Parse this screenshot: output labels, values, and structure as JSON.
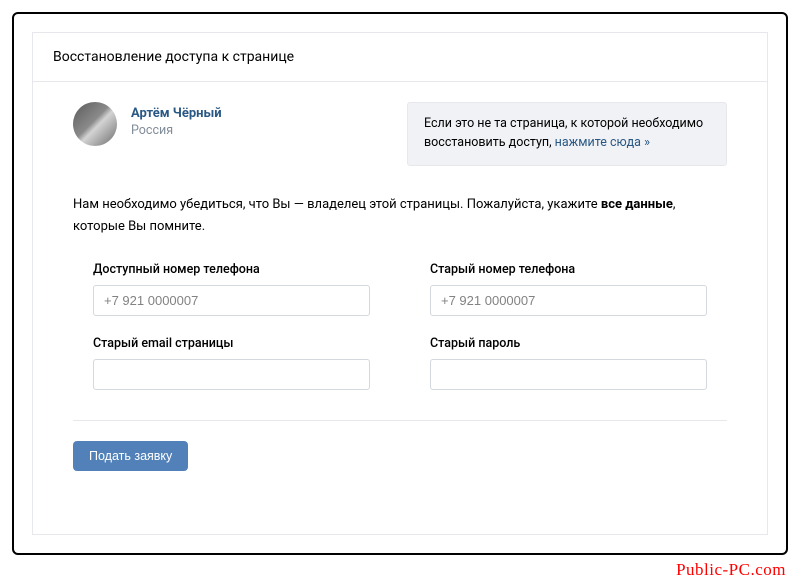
{
  "header": {
    "title": "Восстановление доступа к странице"
  },
  "user": {
    "name": "Артём Чёрный",
    "location": "Россия"
  },
  "infobox": {
    "text_prefix": "Если это не та страница, к которой необходимо восстановить доступ, ",
    "link_text": "нажмите сюда »"
  },
  "instruction": {
    "part1": "Нам необходимо убедиться, что Вы — владелец этой страницы. Пожалуйста, укажите ",
    "bold": "все данные",
    "part2": ", которые Вы помните."
  },
  "fields": {
    "available_phone": {
      "label": "Доступный номер телефона",
      "placeholder": "+7 921 0000007"
    },
    "old_phone": {
      "label": "Старый номер телефона",
      "placeholder": "+7 921 0000007"
    },
    "old_email": {
      "label": "Старый email страницы",
      "placeholder": ""
    },
    "old_password": {
      "label": "Старый пароль",
      "placeholder": ""
    }
  },
  "submit": {
    "label": "Подать заявку"
  },
  "watermark": "Public-PC.com"
}
